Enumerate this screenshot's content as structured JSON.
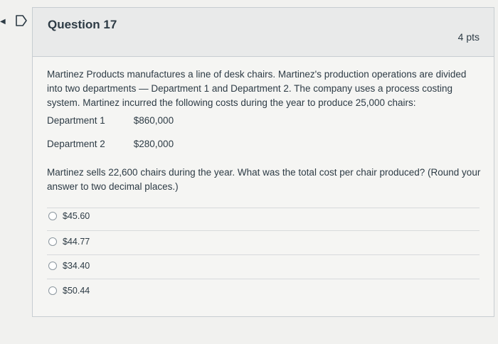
{
  "question": {
    "title": "Question 17",
    "points": "4 pts",
    "body": "Martinez Products manufactures a line of desk chairs. Martinez's production operations are divided into two departments — Department 1 and Department 2. The company uses a process costing system. Martinez incurred the following costs during the year to produce 25,000 chairs:",
    "departments": [
      {
        "name": "Department 1",
        "cost": "$860,000"
      },
      {
        "name": "Department 2",
        "cost": "$280,000"
      }
    ],
    "prompt": "Martinez sells 22,600 chairs during the year. What was the total cost per chair produced? (Round your answer to two decimal places.)",
    "answers": [
      "$45.60",
      "$44.77",
      "$34.40",
      "$50.44"
    ]
  },
  "icons": {
    "flag": "flag-icon",
    "nav": "arrow-icon"
  }
}
